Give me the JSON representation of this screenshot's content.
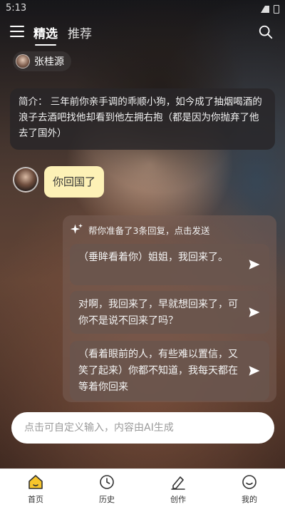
{
  "status_bar": {
    "time": "5:13"
  },
  "top_nav": {
    "tabs": [
      {
        "label": "精选",
        "active": true
      },
      {
        "label": "推荐",
        "active": false
      }
    ]
  },
  "character": {
    "name": "张桂源"
  },
  "intro": {
    "label": "简介：",
    "text": "三年前你亲手调的乖顺小狗，如今成了抽烟喝酒的浪子去酒吧找他却看到他左拥右抱（都是因为你抛弃了他去了国外）"
  },
  "message": {
    "text": "你回国了"
  },
  "suggestions": {
    "header": "帮你准备了3条回复，点击发送",
    "items": [
      {
        "text": "（垂眸看着你）姐姐，我回来了。"
      },
      {
        "text": "对啊，我回来了，早就想回来了，可你不是说不回来了吗？"
      },
      {
        "text": "（看着眼前的人，有些难以置信，又笑了起来）你都不知道，我每天都在等着你回来"
      }
    ]
  },
  "input": {
    "placeholder": "点击可自定义输入，内容由AI生成"
  },
  "bottom_nav": {
    "items": [
      {
        "label": "首页",
        "icon": "home-icon"
      },
      {
        "label": "历史",
        "icon": "clock-icon"
      },
      {
        "label": "创作",
        "icon": "pen-icon"
      },
      {
        "label": "我的",
        "icon": "smile-icon"
      }
    ]
  },
  "colors": {
    "accent_yellow": "#f7c52b",
    "bubble": "#fdf1b6"
  }
}
